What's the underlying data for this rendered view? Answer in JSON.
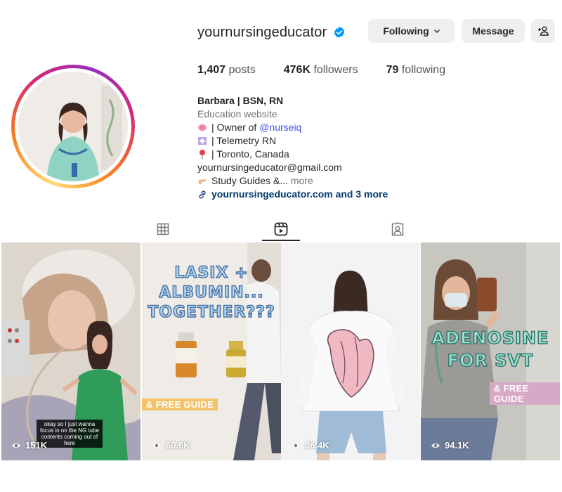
{
  "profile": {
    "username": "yournursingeducator",
    "buttons": {
      "following": "Following",
      "message": "Message"
    },
    "stats": [
      {
        "value": "1,407",
        "label": "posts"
      },
      {
        "value": "476K",
        "label": "followers"
      },
      {
        "value": "79",
        "label": "following"
      }
    ],
    "bio": {
      "name": "Barbara | BSN, RN",
      "category": "Education website",
      "line1_prefix": "| Owner of",
      "line1_mention": "@nurseiq",
      "line2": "| Telemetry RN",
      "line3": "| Toronto, Canada",
      "email": "yournursingeducator@gmail.com",
      "line5": "Study Guides &...",
      "more": "more",
      "external_link": "yournursingeducator.com and 3 more"
    }
  },
  "tabs": [
    {
      "name": "posts",
      "icon": "grid-icon",
      "active": false
    },
    {
      "name": "reels",
      "icon": "reels-icon",
      "active": true
    },
    {
      "name": "tagged",
      "icon": "tagged-icon",
      "active": false
    }
  ],
  "reels": [
    {
      "views": "151K",
      "caption": "okay so I just wanna focus in on the NG tube contents coming out of here"
    },
    {
      "views": "60.6K",
      "title_lines": [
        "LASIX +",
        "ALBUMIN...",
        "TOGETHER???"
      ],
      "tag": "& FREE GUIDE"
    },
    {
      "views": "36.4K"
    },
    {
      "views": "94.1K",
      "title_lines": [
        "ADENOSINE",
        "FOR SVT"
      ],
      "tag": "& FREE GUIDE"
    }
  ],
  "colors": {
    "link": "#4150f7",
    "verified": "#0095f6",
    "button_bg": "#efefef"
  }
}
